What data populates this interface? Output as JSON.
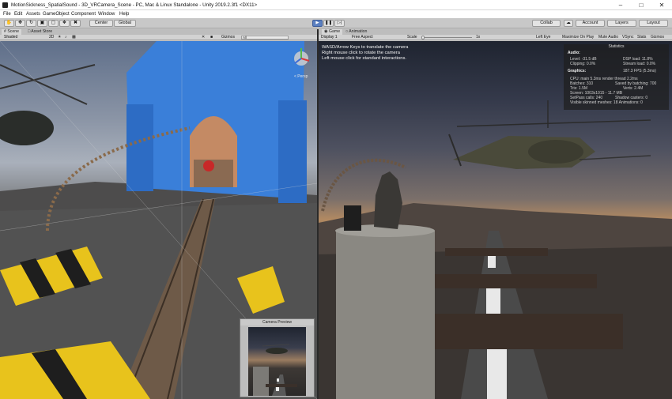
{
  "window": {
    "title": "MotionSickness_SpatialSound - 3D_VRCamera_Scene - PC, Mac & Linux Standalone - Unity 2019.2.3f1 <DX11>"
  },
  "menu": [
    "File",
    "Edit",
    "Assets",
    "GameObject",
    "Component",
    "Window",
    "Help"
  ],
  "toolbar": {
    "pivot_label": "Center",
    "space_label": "Global",
    "collab_label": "Collab",
    "account_label": "Account",
    "layers_label": "Layers",
    "layout_label": "Layout"
  },
  "scene_panel": {
    "tabs": [
      "Scene",
      "Asset Store"
    ],
    "shading_mode": "Shaded",
    "mode_2d": "2D",
    "gizmos_label": "Gizmos",
    "search_placeholder": "All",
    "persp_label": "< Persp"
  },
  "game_panel": {
    "tabs": [
      "Game",
      "Animation"
    ],
    "display": "Display 1",
    "aspect": "Free Aspect",
    "scale_label": "Scale",
    "scale_value": "1x",
    "eye": "Left Eye",
    "buttons": [
      "Maximize On Play",
      "Mute Audio",
      "VSync",
      "Stats",
      "Gizmos"
    ],
    "instructions": [
      "WASD/Arrow Keys to translate the camera",
      "Right mouse click to rotate the camera",
      "Left mouse click for standard interactions."
    ]
  },
  "stats": {
    "title": "Statistics",
    "audio_header": "Audio:",
    "level": "Level: -31.5 dB",
    "dsp_load": "DSP load: 11.8%",
    "clipping": "Clipping: 0.0%",
    "stream_load": "Stream load: 0.0%",
    "graphics_header": "Graphics:",
    "fps": "187.3 FPS (5.3ms)",
    "cpu": "CPU: main 5.3ms  render thread 2.2ms",
    "batches": "Batches: 310",
    "saved_batching": "Saved by batching: 700",
    "tris": "Tris: 1.5M",
    "verts": "Verts: 2.4M",
    "screen": "Screen: 1003x1015 - 11.7 MB",
    "setpass": "SetPass calls: 240",
    "shadow_casters": "Shadow casters: 0",
    "skinned": "Visible skinned meshes: 18  Animations: 0"
  },
  "camera_preview": {
    "title": "Camera Preview"
  },
  "colors": {
    "play_accent": "#5a7fc0",
    "scene_sky": "#8b95a6",
    "game_horizon": "#b38a62",
    "building_blue": "#3a7fd9",
    "hazard_yellow": "#e8c31c"
  }
}
